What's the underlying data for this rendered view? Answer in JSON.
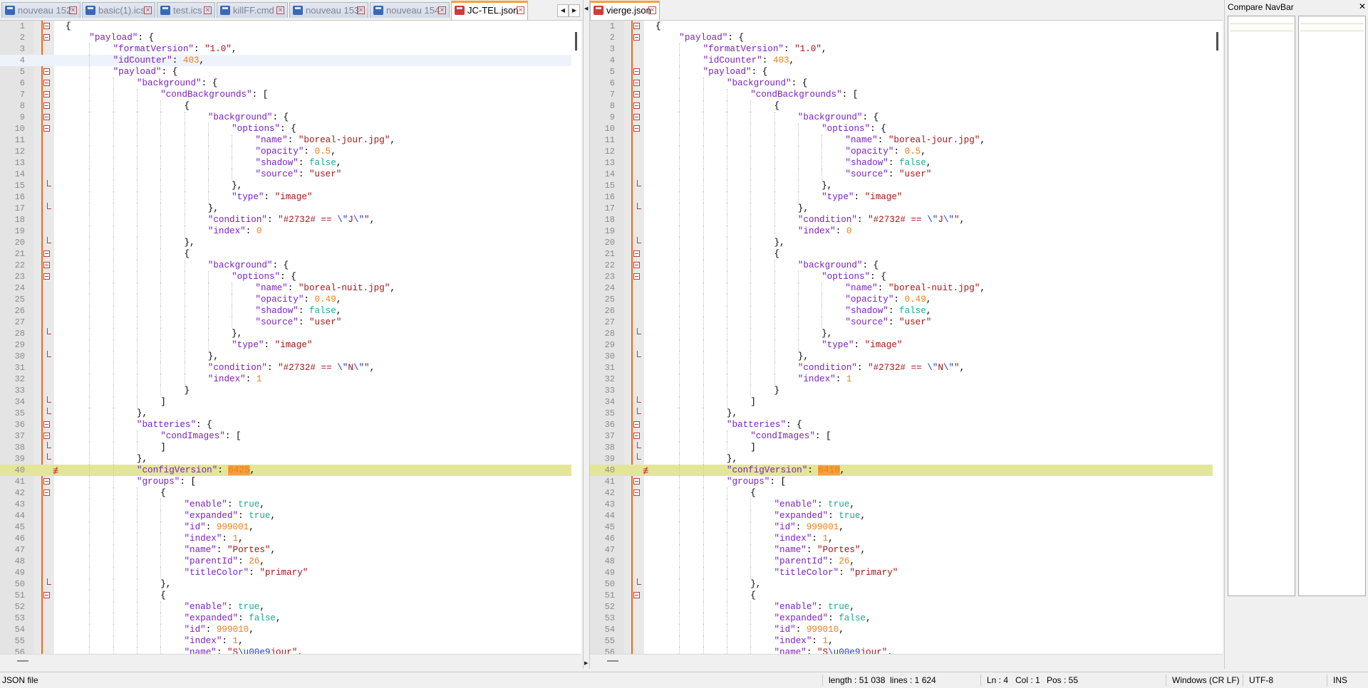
{
  "left_tabs": [
    {
      "label": "nouveau 152",
      "active": false
    },
    {
      "label": "basic(1).ics",
      "active": false
    },
    {
      "label": "test.ics",
      "active": false
    },
    {
      "label": "killFF.cmd",
      "active": false
    },
    {
      "label": "nouveau 153",
      "active": false
    },
    {
      "label": "nouveau 154",
      "active": false
    },
    {
      "label": "JC-TEL.json",
      "active": true
    }
  ],
  "right_tabs": [
    {
      "label": "vierge.json",
      "active": true
    }
  ],
  "tab_scroll": {
    "left": "◀",
    "right": "▶"
  },
  "nav_panel": {
    "title": "Compare NavBar",
    "close": "✕"
  },
  "editor_left": {
    "config_version": "6425",
    "caret_line": 4
  },
  "editor_right": {
    "config_version": "6410"
  },
  "status": {
    "file_type": "JSON file",
    "length": "length : 51 038",
    "lines": "lines : 1 624",
    "ln": "Ln : 4",
    "col": "Col : 1",
    "pos": "Pos : 55",
    "eol": "Windows (CR LF)",
    "encoding": "UTF-8",
    "mode": "INS"
  },
  "colors": {
    "keyword": "#7b20c6",
    "string": "#a31515",
    "number": "#ee7e1a",
    "bool": "#1ba891",
    "fold_bar": "#f06b1b",
    "diff_line": "#e3e699"
  }
}
